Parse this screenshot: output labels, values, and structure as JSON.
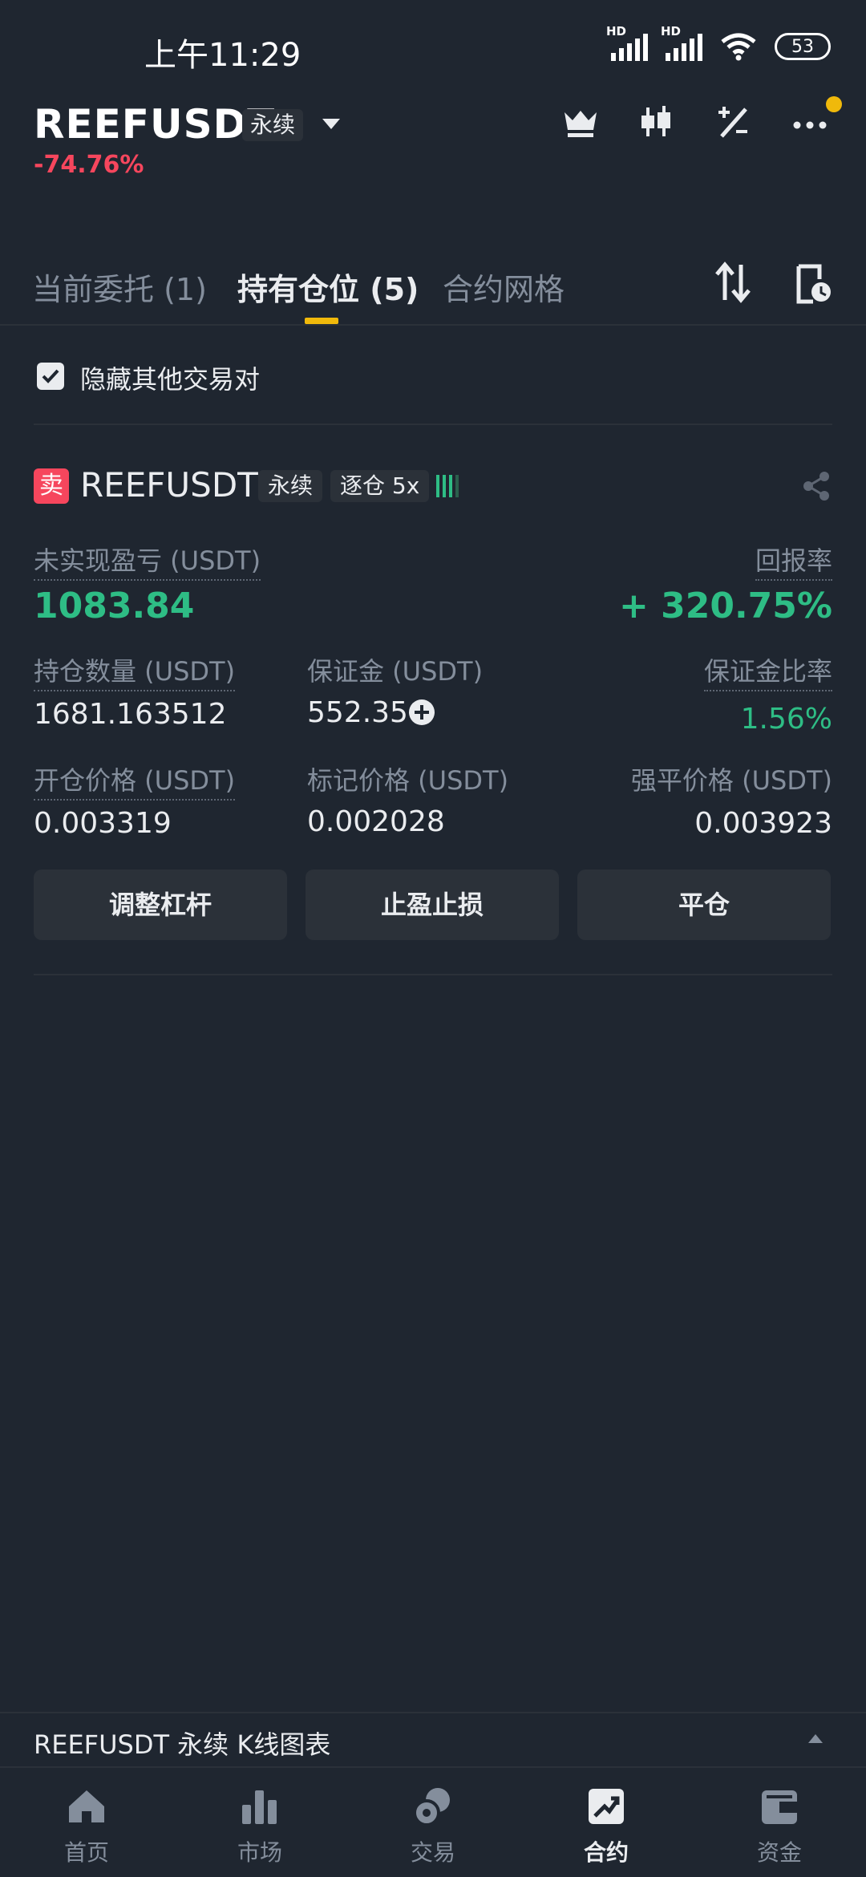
{
  "status_bar": {
    "time": "上午11:29",
    "hd1": "HD",
    "hd2": "HD",
    "battery": "53"
  },
  "header": {
    "symbol": "REEFUSDT",
    "contract_type": "永续",
    "change": "-74.76%"
  },
  "tabs": [
    {
      "label": "当前委托 (1)"
    },
    {
      "label": "持有仓位 (5)"
    },
    {
      "label": "合约网格"
    }
  ],
  "filter": {
    "hide_others_label": "隐藏其他交易对",
    "checked": true
  },
  "position": {
    "side": "卖",
    "symbol": "REEFUSDT",
    "contract_type": "永续",
    "margin_mode": "逐仓 5x",
    "unrealized_pnl_label": "未实现盈亏 (USDT)",
    "unrealized_pnl": "1083.84",
    "roe_label": "回报率",
    "roe": "+ 320.75%",
    "size_label": "持仓数量 (USDT)",
    "size": "1681.163512",
    "margin_label": "保证金 (USDT)",
    "margin": "552.35",
    "margin_ratio_label": "保证金比率",
    "margin_ratio": "1.56%",
    "entry_price_label": "开仓价格 (USDT)",
    "entry_price": "0.003319",
    "mark_price_label": "标记价格 (USDT)",
    "mark_price": "0.002028",
    "liq_price_label": "强平价格 (USDT)",
    "liq_price": "0.003923",
    "buttons": {
      "leverage": "调整杠杆",
      "tpsl": "止盈止损",
      "close": "平仓"
    }
  },
  "chart_bar": {
    "label": "REEFUSDT 永续  K线图表"
  },
  "nav": [
    {
      "label": "首页"
    },
    {
      "label": "市场"
    },
    {
      "label": "交易"
    },
    {
      "label": "合约"
    },
    {
      "label": "资金"
    }
  ],
  "colors": {
    "green": "#2ebd85",
    "red": "#f6465d",
    "accent": "#f0b90b",
    "bg": "#1f2630"
  }
}
